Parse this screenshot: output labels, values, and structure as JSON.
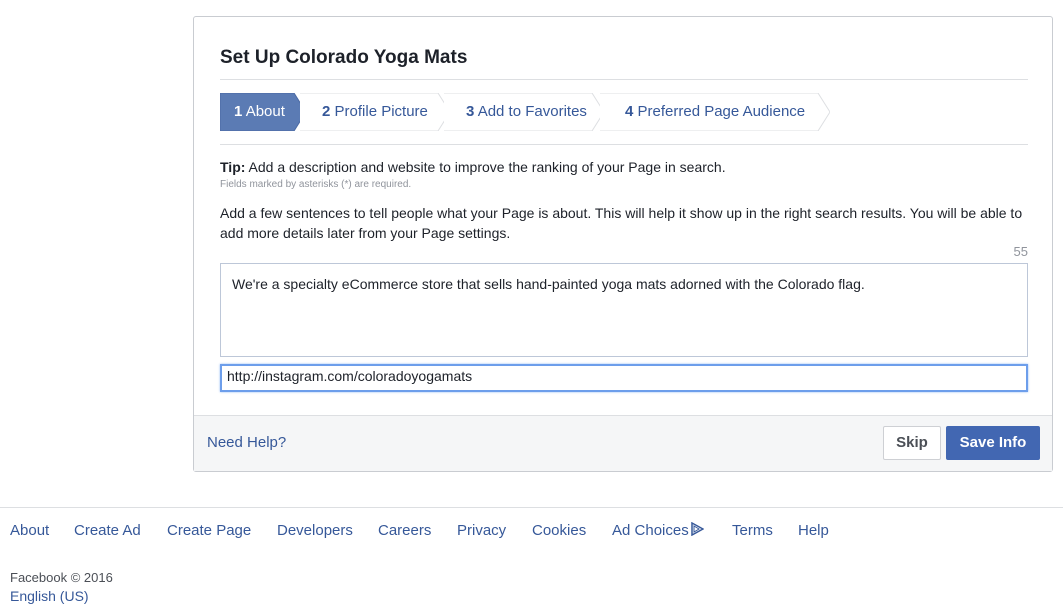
{
  "dialog": {
    "title": "Set Up Colorado Yoga Mats",
    "steps": [
      {
        "num": "1",
        "label": "About",
        "active": true
      },
      {
        "num": "2",
        "label": "Profile Picture",
        "active": false
      },
      {
        "num": "3",
        "label": "Add to Favorites",
        "active": false
      },
      {
        "num": "4",
        "label": "Preferred Page Audience",
        "active": false
      }
    ],
    "tip_label": "Tip:",
    "tip_text": "Add a description and website to improve the ranking of your Page in search.",
    "required_note": "Fields marked by asterisks (*) are required.",
    "description": "Add a few sentences to tell people what your Page is about. This will help it show up in the right search results. You will be able to add more details later from your Page settings.",
    "char_counter": "55",
    "about_value": "We're a specialty eCommerce store that sells hand-painted yoga mats adorned with the Colorado flag.",
    "website_value": "http://instagram.com/coloradoyogamats",
    "help_link": "Need Help?",
    "skip_label": "Skip",
    "save_label": "Save Info"
  },
  "footer": {
    "links": [
      "About",
      "Create Ad",
      "Create Page",
      "Developers",
      "Careers",
      "Privacy",
      "Cookies",
      "Ad Choices",
      "Terms",
      "Help"
    ],
    "copyright": "Facebook © 2016",
    "language": "English (US)"
  },
  "colors": {
    "accent": "#4267b2",
    "link": "#365899",
    "active_step": "#5b7bb4",
    "focus_border": "#6d9eeb"
  },
  "icons": {
    "ad_choices": "ad-choices-triangle-icon"
  }
}
